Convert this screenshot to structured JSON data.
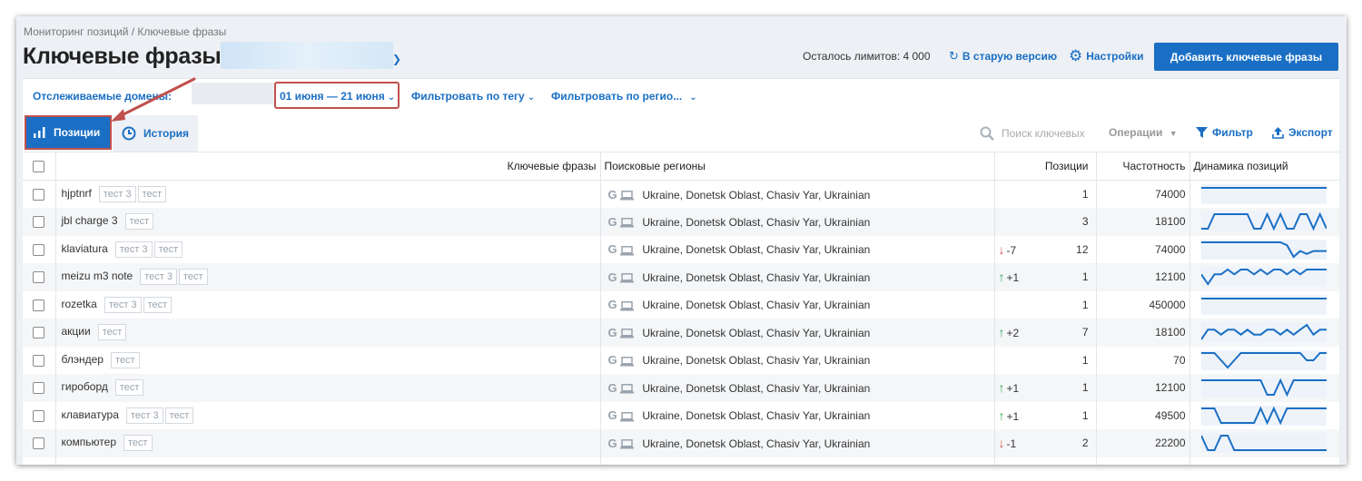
{
  "header": {
    "breadcrumb": "Мониторинг позиций / Ключевые фразы",
    "title": "Ключевые фразы",
    "limits": "Осталось лимитов: 4 000",
    "old_version": "В старую версию",
    "settings": "Настройки",
    "add_button": "Добавить ключевые фразы"
  },
  "filters": {
    "domains_label": "Отслеживаемые домены:",
    "date_range": "01 июня — 21 июня",
    "tag_filter": "Фильтровать по тегу",
    "region_filter": "Фильтровать по регио..."
  },
  "tabs": {
    "positions": "Позиции",
    "history": "История"
  },
  "toolbar": {
    "search_placeholder": "Поиск ключевых",
    "operations": "Операции",
    "filter": "Фильтр",
    "export": "Экспорт"
  },
  "table": {
    "headers": {
      "phrase": "Ключевые фразы",
      "regions": "Поисковые регионы",
      "positions": "Позиции",
      "frequency": "Частотность",
      "dynamics": "Динамика позиций"
    },
    "region_text": "Ukraine, Donetsk Oblast, Chasiv Yar, Ukrainian",
    "g_label": "G",
    "rows": [
      {
        "phrase": "hjptnrf",
        "tags": [
          "тест 3",
          "тест"
        ],
        "change": "",
        "dir": "",
        "position": "1",
        "frequency": "74000",
        "spark": [
          1,
          1,
          1,
          1,
          1,
          1,
          1,
          1,
          1,
          1,
          1,
          1,
          1,
          1,
          1,
          1,
          1,
          1,
          1,
          1
        ]
      },
      {
        "phrase": "jbl charge 3",
        "tags": [
          "тест"
        ],
        "change": "",
        "dir": "",
        "position": "3",
        "frequency": "18100",
        "spark": [
          3,
          3,
          2,
          2,
          2,
          2,
          2,
          2,
          3,
          3,
          2,
          3,
          2,
          3,
          3,
          2,
          2,
          3,
          2,
          3
        ]
      },
      {
        "phrase": "klaviatura",
        "tags": [
          "тест 3",
          "тест"
        ],
        "change": "-7",
        "dir": "down",
        "position": "12",
        "frequency": "74000",
        "spark": [
          2,
          2,
          2,
          2,
          2,
          2,
          2,
          2,
          2,
          2,
          2,
          2,
          2,
          3,
          7,
          5,
          6,
          5,
          5,
          5
        ]
      },
      {
        "phrase": "meizu m3 note",
        "tags": [
          "тест 3",
          "тест"
        ],
        "change": "+1",
        "dir": "up",
        "position": "1",
        "frequency": "12100",
        "spark": [
          3,
          5,
          3,
          3,
          2,
          3,
          2,
          2,
          3,
          2,
          3,
          2,
          2,
          3,
          2,
          3,
          2,
          2,
          2,
          2
        ]
      },
      {
        "phrase": "rozetka",
        "tags": [
          "тест 3",
          "тест"
        ],
        "change": "",
        "dir": "",
        "position": "1",
        "frequency": "450000",
        "spark": [
          1,
          1,
          1,
          1,
          1,
          1,
          1,
          1,
          1,
          1,
          1,
          1,
          1,
          1,
          1,
          1,
          1,
          1,
          1,
          1
        ]
      },
      {
        "phrase": "акции",
        "tags": [
          "тест"
        ],
        "change": "+2",
        "dir": "up",
        "position": "7",
        "frequency": "18100",
        "spark": [
          9,
          7,
          7,
          8,
          7,
          7,
          8,
          7,
          8,
          8,
          7,
          7,
          8,
          7,
          8,
          7,
          6,
          8,
          7,
          7
        ]
      },
      {
        "phrase": "блэндер",
        "tags": [
          "тест"
        ],
        "change": "",
        "dir": "",
        "position": "1",
        "frequency": "70",
        "spark": [
          1,
          1,
          1,
          2,
          3,
          2,
          1,
          1,
          1,
          1,
          1,
          1,
          1,
          1,
          1,
          1,
          2,
          2,
          1,
          1
        ]
      },
      {
        "phrase": "гироборд",
        "tags": [
          "тест"
        ],
        "change": "+1",
        "dir": "up",
        "position": "1",
        "frequency": "12100",
        "spark": [
          2,
          2,
          2,
          2,
          2,
          2,
          2,
          2,
          2,
          2,
          3,
          3,
          2,
          3,
          2,
          2,
          2,
          2,
          2,
          2
        ]
      },
      {
        "phrase": "клавиатура",
        "tags": [
          "тест 3",
          "тест"
        ],
        "change": "+1",
        "dir": "up",
        "position": "1",
        "frequency": "49500",
        "spark": [
          1,
          1,
          1,
          3,
          3,
          3,
          3,
          3,
          3,
          1,
          3,
          1,
          3,
          1,
          1,
          1,
          1,
          1,
          1,
          1
        ]
      },
      {
        "phrase": "компьютер",
        "tags": [
          "тест"
        ],
        "change": "-1",
        "dir": "down",
        "position": "2",
        "frequency": "22200",
        "spark": [
          1,
          3,
          3,
          1,
          1,
          3,
          3,
          3,
          3,
          3,
          3,
          3,
          3,
          3,
          3,
          3,
          3,
          3,
          3,
          3
        ]
      }
    ]
  },
  "colors": {
    "accent": "#1a6fc4",
    "annotation": "#c0504d",
    "up": "#3aa655",
    "down": "#d9534f"
  }
}
